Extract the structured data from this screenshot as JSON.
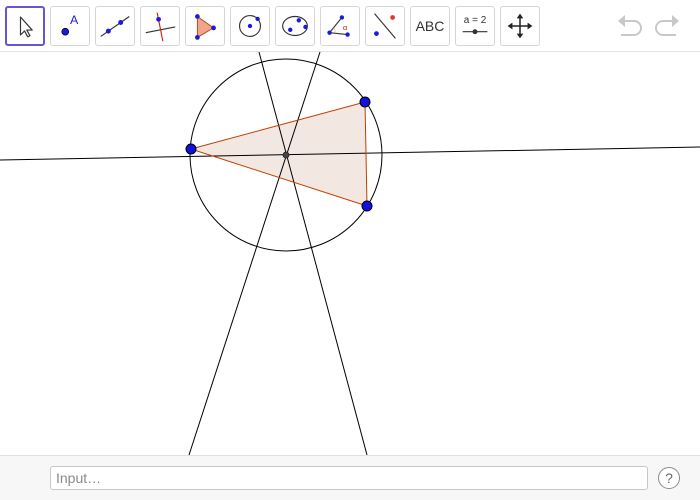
{
  "toolbar": {
    "tools": [
      {
        "name": "move-tool",
        "icon": "arrow-cursor-icon"
      },
      {
        "name": "point-tool",
        "icon": "point-with-label-icon",
        "label": "A"
      },
      {
        "name": "line-tool",
        "icon": "line-through-two-points-icon"
      },
      {
        "name": "perpendicular-line-tool",
        "icon": "perpendicular-line-icon"
      },
      {
        "name": "polygon-tool",
        "icon": "polygon-icon"
      },
      {
        "name": "circle-tool",
        "icon": "circle-center-point-icon"
      },
      {
        "name": "conic-tool",
        "icon": "ellipse-icon"
      },
      {
        "name": "angle-tool",
        "icon": "angle-icon",
        "label": "α"
      },
      {
        "name": "reflect-tool",
        "icon": "reflect-about-line-icon"
      },
      {
        "name": "text-tool",
        "icon": "text-icon",
        "label": "ABC"
      },
      {
        "name": "slider-tool",
        "icon": "slider-icon",
        "label": "a = 2"
      },
      {
        "name": "move-graphics-view-tool",
        "icon": "move-arrows-icon"
      }
    ],
    "undo_icon": "undo-icon",
    "redo_icon": "redo-icon"
  },
  "colors": {
    "accent": "#6557d2",
    "point_blue": "#1010e0",
    "triangle_edge": "#c04000",
    "triangle_fill": "#f3e7e2",
    "line": "#000000"
  },
  "input_bar": {
    "placeholder": "Input…",
    "help_label": "?"
  }
}
